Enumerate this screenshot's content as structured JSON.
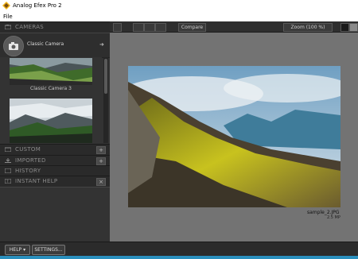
{
  "window": {
    "title": "Analog Efex Pro 2"
  },
  "menu": {
    "file": "File"
  },
  "sidebar": {
    "cameras_label": "CAMERAS",
    "selected_camera": "Classic Camera",
    "thumbnails": [
      {
        "label": "Classic Camera 3"
      },
      {
        "label": ""
      }
    ],
    "sections": [
      {
        "label": "CUSTOM",
        "icon": "folder-icon",
        "has_add": true
      },
      {
        "label": "IMPORTED",
        "icon": "import-icon",
        "has_add": true
      },
      {
        "label": "HISTORY",
        "icon": "history-icon",
        "has_add": false
      },
      {
        "label": "INSTANT HELP",
        "icon": "help-icon",
        "has_add": true
      }
    ]
  },
  "toolbar": {
    "compare": "Compare",
    "zoom": "Zoom (100 %)"
  },
  "image": {
    "file_name": "sample_2.JPG",
    "file_size": "2.5 MP"
  },
  "footer": {
    "help": "HELP",
    "settings": "SETTINGS..."
  },
  "colors": {
    "accent": "#2a8fbd",
    "panel": "#333333",
    "canvas": "#737373"
  }
}
